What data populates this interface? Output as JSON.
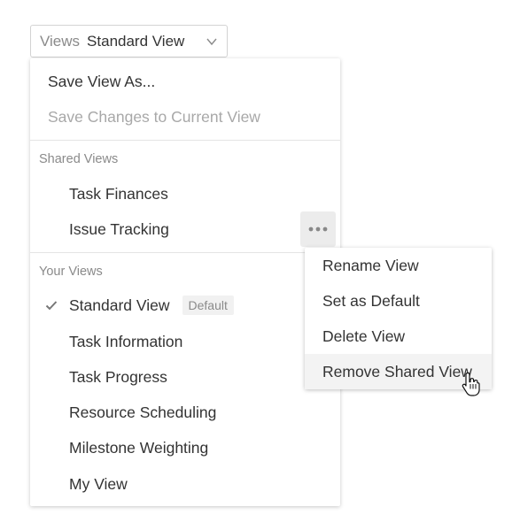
{
  "selector": {
    "prefix": "Views",
    "value": "Standard View",
    "icon": "chevron-down-icon"
  },
  "menu": {
    "save_as": "Save View As...",
    "save_changes": "Save Changes to Current View",
    "shared_label": "Shared Views",
    "shared_views": [
      "Task Finances",
      "Issue Tracking"
    ],
    "your_label": "Your Views",
    "your_views": [
      "Standard View",
      "Task Information",
      "Task Progress",
      "Resource Scheduling",
      "Milestone Weighting",
      "My View"
    ],
    "default_badge": "Default",
    "selected_icon": "checkmark-icon",
    "more_icon": "ellipsis-icon"
  },
  "submenu": {
    "items": [
      "Rename View",
      "Set as Default",
      "Delete View",
      "Remove Shared View"
    ]
  },
  "colors": {
    "text": "#333333",
    "muted": "#8a8a8a",
    "disabled": "#a8a8a8",
    "hover": "#f3f3f3"
  }
}
